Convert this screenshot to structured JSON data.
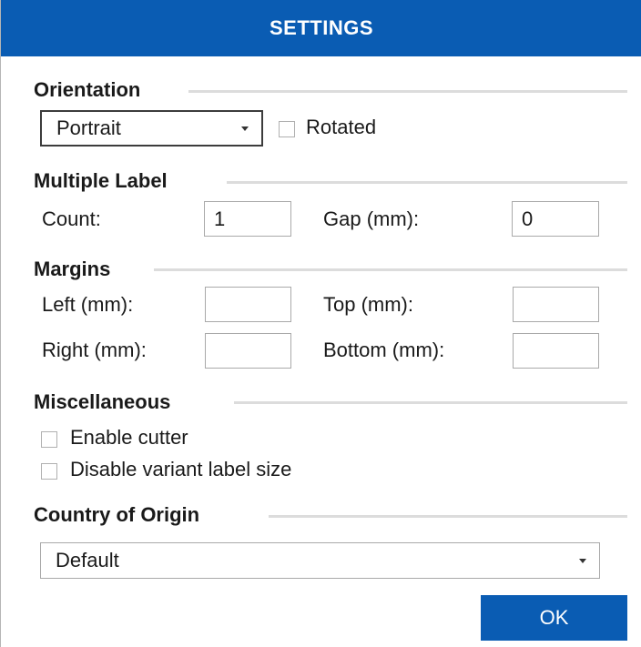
{
  "title": "SETTINGS",
  "orientation": {
    "heading": "Orientation",
    "select_value": "Portrait",
    "rotated_label": "Rotated",
    "rotated_checked": false
  },
  "multiple_label": {
    "heading": "Multiple Label",
    "count_label": "Count:",
    "count_value": "1",
    "gap_label": "Gap (mm):",
    "gap_value": "0"
  },
  "margins": {
    "heading": "Margins",
    "left_label": "Left (mm):",
    "left_value": "",
    "top_label": "Top (mm):",
    "top_value": "",
    "right_label": "Right (mm):",
    "right_value": "",
    "bottom_label": "Bottom (mm):",
    "bottom_value": ""
  },
  "misc": {
    "heading": "Miscellaneous",
    "enable_cutter_label": "Enable cutter",
    "enable_cutter_checked": false,
    "disable_variant_label": "Disable variant label size",
    "disable_variant_checked": false
  },
  "country": {
    "heading": "Country of Origin",
    "select_value": "Default"
  },
  "ok_label": "OK",
  "colors": {
    "accent": "#0a5cb3"
  },
  "icons": {
    "dropdown": "chevron-down-icon",
    "checkbox": "checkbox-icon"
  }
}
